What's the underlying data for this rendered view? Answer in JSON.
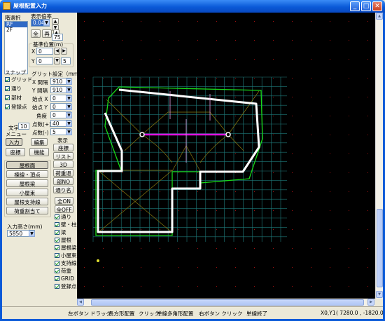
{
  "window": {
    "title": "屋根配置入力"
  },
  "layer_select": {
    "label": "階選択",
    "items": [
      "RF",
      "2F"
    ],
    "selected": 0
  },
  "zoom": {
    "label": "表示倍率",
    "value": "0.040",
    "full_button": "全",
    "redraw_button": "再",
    "step_value": "75"
  },
  "origin": {
    "label": "基準位置(m)",
    "x_label": "X",
    "x_value": "0",
    "y_label": "Y",
    "y_value": "0",
    "y_extra": "5"
  },
  "snap": {
    "label": "スナップ",
    "items": [
      "グリッド",
      "通り",
      "部材",
      "登録点"
    ]
  },
  "grid_settings": {
    "label": "グリット設定（mm）",
    "rows": [
      {
        "label": "X 間隔",
        "value": "910"
      },
      {
        "label": "Y 間隔",
        "value": "910"
      },
      {
        "label": "始点 X",
        "value": "0"
      },
      {
        "label": "始点 Y",
        "value": "0"
      },
      {
        "label": "角度",
        "value": "0"
      },
      {
        "label": "点数(+)",
        "value": "40"
      },
      {
        "label": "点数(-)",
        "value": "5"
      }
    ]
  },
  "text_size": {
    "label": "文字",
    "value": "10"
  },
  "menu": {
    "label": "メニュー",
    "input_tab": "入力",
    "edit_tab": "編集",
    "coord_button": "座標",
    "func_button": "機能"
  },
  "display": {
    "label": "表示",
    "buttons": [
      "座標",
      "リスト",
      "3D",
      "荷重退",
      "部NO",
      "通り名"
    ],
    "on_button": "全ON",
    "off_button": "全OFF",
    "checks": [
      "通り",
      "壁・柱",
      "梁",
      "屋根",
      "屋根梁",
      "小屋束",
      "支持線",
      "荷重",
      "GRID",
      "登録点"
    ]
  },
  "actions": [
    "屋根面",
    "棟線・頂点",
    "屋根梁",
    "小屋束",
    "屋根支持線",
    "荷重割当て"
  ],
  "input_height": {
    "label": "入力高さ(mm)",
    "value": "5850"
  },
  "status_bar": {
    "left_button": "左ボタン",
    "drag": "ドラッグ",
    "drag_action": "長方形配置",
    "click": "クリック",
    "click_action": "単線多角形配置",
    "right_button": "右ボタン クリック",
    "right_action": "単線終了",
    "coord_label": "X0,Y1",
    "coord_value": "( 7280.0 , -1820.0 )"
  }
}
